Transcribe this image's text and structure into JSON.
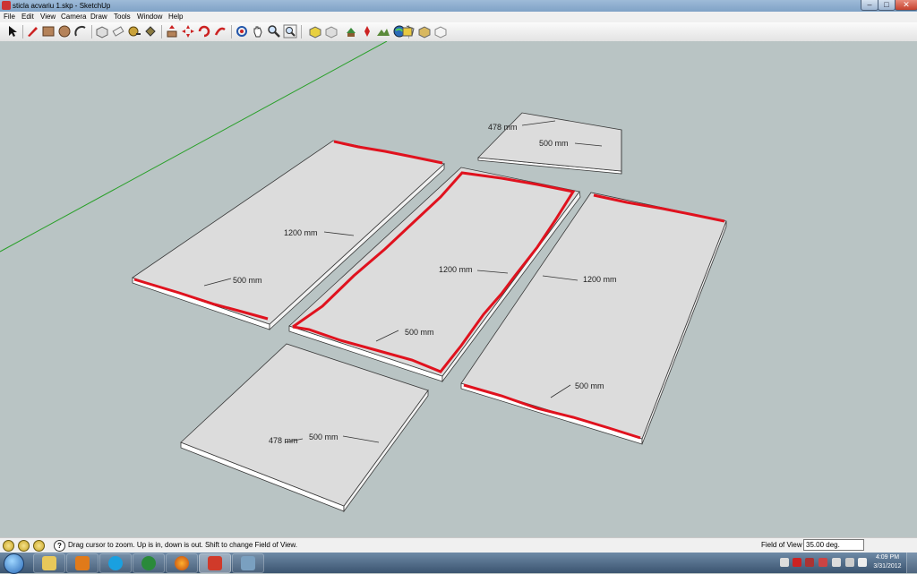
{
  "window": {
    "title": "sticla acvariu 1.skp - SketchUp",
    "minimize_glyph": "–",
    "maximize_glyph": "□",
    "close_glyph": "✕"
  },
  "menu": [
    "File",
    "Edit",
    "View",
    "Camera",
    "Draw",
    "Tools",
    "Window",
    "Help"
  ],
  "toolbar": {
    "tools": [
      "select-tool-icon",
      "pencil-line-tool-icon",
      "rectangle-tool-icon",
      "circle-tool-icon",
      "arc-tool-icon",
      "make-component-icon",
      "eraser-icon",
      "tape-measure-icon",
      "paint-bucket-icon",
      "push-pull-icon",
      "move-icon",
      "rotate-icon",
      "follow-me-icon",
      "orbit-icon",
      "pan-icon",
      "zoom-icon",
      "zoom-extents-icon",
      "get-models-icon",
      "share-model-icon",
      "share-component-icon",
      "add-location-icon",
      "toggle-terrain-icon",
      "photo-textures-icon",
      "preview-google-earth-icon",
      "component-options-icon"
    ]
  },
  "dimensions": {
    "top_small_width": "478 mm",
    "top_small_length": "500 mm",
    "left_panel_length": "1200 mm",
    "left_panel_width": "500 mm",
    "center_panel_length": "1200 mm",
    "center_panel_width": "500 mm",
    "right_panel_length": "1200 mm",
    "right_panel_width": "500 mm",
    "bottom_small_width": "478 mm",
    "bottom_small_length": "500 mm"
  },
  "colors": {
    "viewport_bg": "#b9c4c4",
    "panel_face": "#dcdcdc",
    "panel_edge": "#ffffff",
    "highlight_red": "#e0121e",
    "green_axis": "#2aa02a"
  },
  "status": {
    "message": "Drag cursor to zoom.  Up is in, down is out. Shift to change Field of View.",
    "fov_label": "Field of View",
    "fov_value": "35.00 deg."
  },
  "taskbar": {
    "apps": [
      "windows-explorer-icon",
      "media-player-icon",
      "skype-icon",
      "media-center-icon",
      "firefox-icon",
      "sketchup-icon",
      "photo-viewer-icon"
    ],
    "time": "4:09 PM",
    "date": "3/31/2012"
  }
}
